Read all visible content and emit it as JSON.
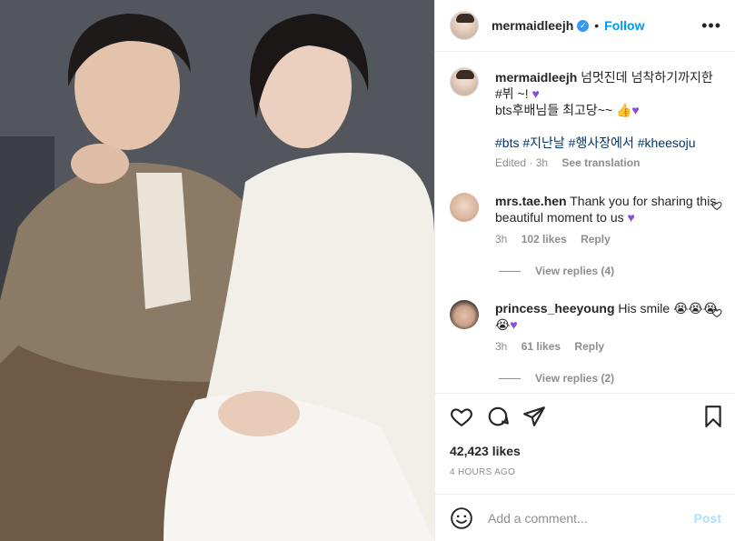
{
  "post": {
    "username": "mermaidleejh",
    "verified_icon": "verified-badge-icon",
    "separator": "•",
    "follow_label": "Follow",
    "more_icon": "more-options-icon"
  },
  "caption": {
    "username": "mermaidleejh",
    "line1": "넘멋진데 넘착하기까지한 #뷔 ~!",
    "line2": "bts후배님들 최고당~~",
    "hashtags": "#bts #지난날 #행사장에서 #kheesoju",
    "edited": "Edited · 3h",
    "see_translation": "See translation"
  },
  "comments": [
    {
      "username": "mrs.tae.hen",
      "text": "Thank you for sharing this beautiful moment to us",
      "age": "3h",
      "likes": "102 likes",
      "reply": "Reply",
      "view_replies": "View replies (4)"
    },
    {
      "username": "princess_heeyoung",
      "text": "His smile",
      "age": "3h",
      "likes": "61 likes",
      "reply": "Reply",
      "view_replies": "View replies (2)"
    }
  ],
  "stats": {
    "likes": "42,423 likes",
    "time": "4 HOURS AGO"
  },
  "add_comment": {
    "placeholder": "Add a comment...",
    "post_label": "Post"
  },
  "icons": [
    "heart-icon",
    "comment-icon",
    "share-icon",
    "bookmark-icon",
    "emoji-icon"
  ],
  "colors": {
    "follow": "#0095f6",
    "post_disabled": "#b2dffc",
    "hashtag": "#00376b",
    "muted": "#8e8e8e"
  }
}
